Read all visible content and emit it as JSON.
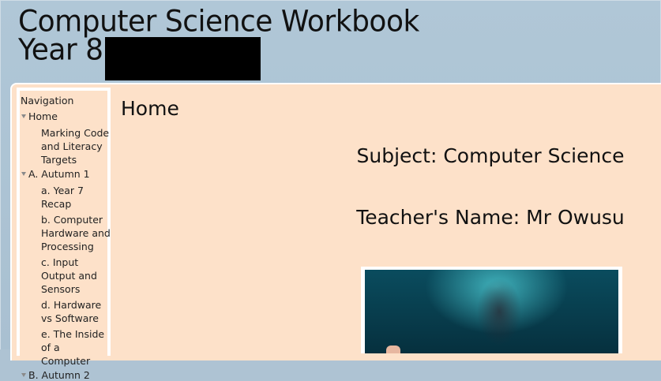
{
  "header": {
    "title_line1": "Computer Science Workbook",
    "title_line2": "Year 8"
  },
  "nav": {
    "title": "Navigation",
    "items": [
      {
        "label": "Home",
        "expanded": true,
        "children": [
          "Marking Code and Literacy Targets"
        ]
      },
      {
        "label": "A. Autumn 1",
        "expanded": true,
        "children": [
          "a. Year 7 Recap",
          "b. Computer Hardware and Processing",
          "c. Input Output and Sensors",
          "d. Hardware vs Software",
          "e. The Inside of a Computer"
        ]
      },
      {
        "label": "B. Autumn 2",
        "expanded": true,
        "children": []
      }
    ]
  },
  "main": {
    "heading": "Home",
    "subject": "Subject: Computer Science",
    "teacher": "Teacher's Name: Mr Owusu"
  },
  "colors": {
    "background": "#aec3d3",
    "content_panel": "#fde1c9",
    "redaction": "#000000"
  }
}
